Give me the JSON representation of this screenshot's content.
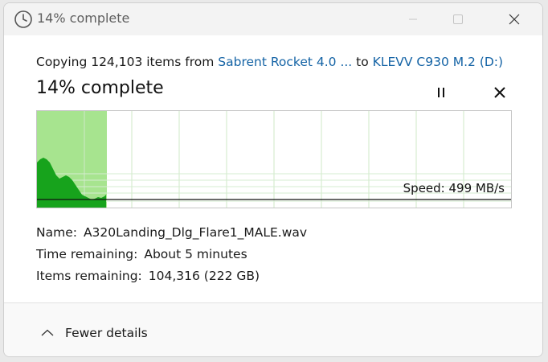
{
  "window": {
    "title": "14% complete",
    "icon": "progress-clock-icon"
  },
  "copy": {
    "prefix": "Copying 124,103 items from ",
    "source": "Sabrent Rocket 4.0 ...",
    "middle": " to ",
    "destination": "KLEVV C930 M.2 (D:)"
  },
  "progress": {
    "title": "14% complete",
    "percent": 14,
    "speed_label": "Speed: 499 MB/s",
    "speed_mbps": 499,
    "fill_color": "#a7e48f",
    "area_color": "#17a31c"
  },
  "details": {
    "name_label": "Name:",
    "name_value": "A320Landing_Dlg_Flare1_MALE.wav",
    "time_label": "Time remaining:",
    "time_value": "About 5 minutes",
    "items_label": "Items remaining:",
    "items_value": "104,316 (222 GB)"
  },
  "footer": {
    "toggle_label": "Fewer details",
    "toggle_icon": "chevron-up-icon"
  }
}
